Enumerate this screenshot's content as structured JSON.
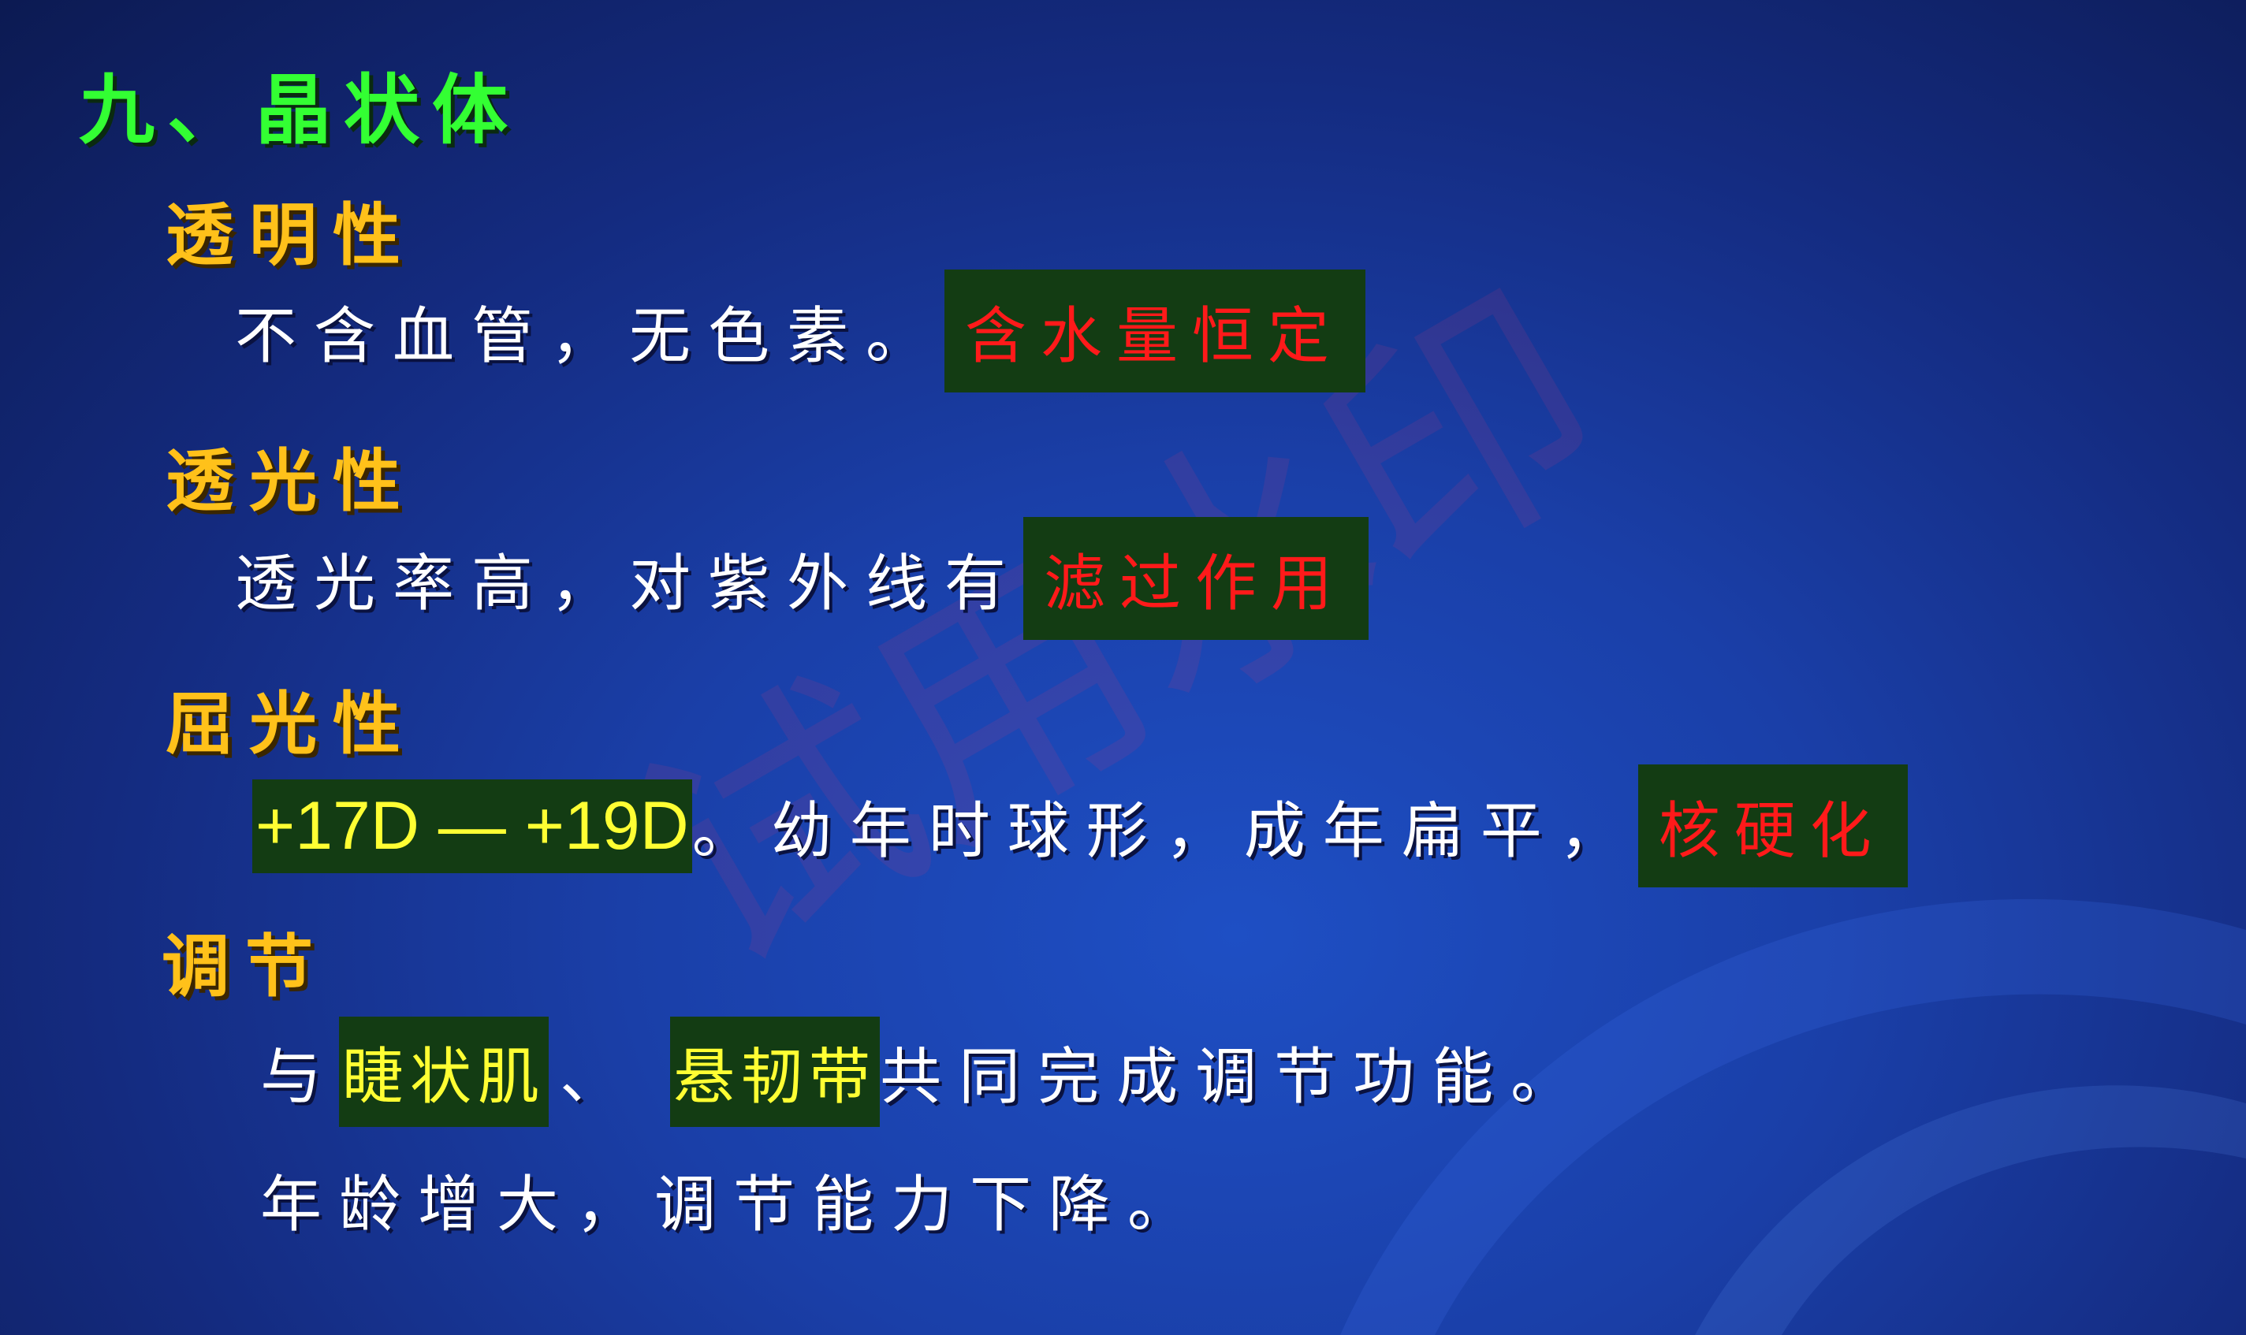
{
  "title": "九、晶状体",
  "sections": {
    "transparency": {
      "heading": "透明性",
      "text": "不含血管，无色素。",
      "highlight": "含水量恒定"
    },
    "transmittance": {
      "heading": "透光性",
      "text": "透光率高，对紫外线有",
      "highlight": "滤过作用"
    },
    "refraction": {
      "heading": "屈光性",
      "diopter": "+17D — +19D",
      "text": "。幼年时球形，成年扁平，",
      "highlight": "核硬化"
    },
    "accommodation": {
      "heading": "调节",
      "line1_prefix": "与",
      "line1_term1": "睫状肌",
      "line1_sep": "、",
      "line1_term2": "悬韧带",
      "line1_suffix": "共同完成调节功能。",
      "line2": "年龄增大，调节能力下降。"
    }
  },
  "watermark": "试用水印",
  "colors": {
    "title": "#33ff33",
    "heading": "#ffc11a",
    "body": "#ffffff",
    "highlight_red": "#ff1a1a",
    "highlight_yellow": "#ffff33",
    "highlight_bg": "#133c13"
  }
}
